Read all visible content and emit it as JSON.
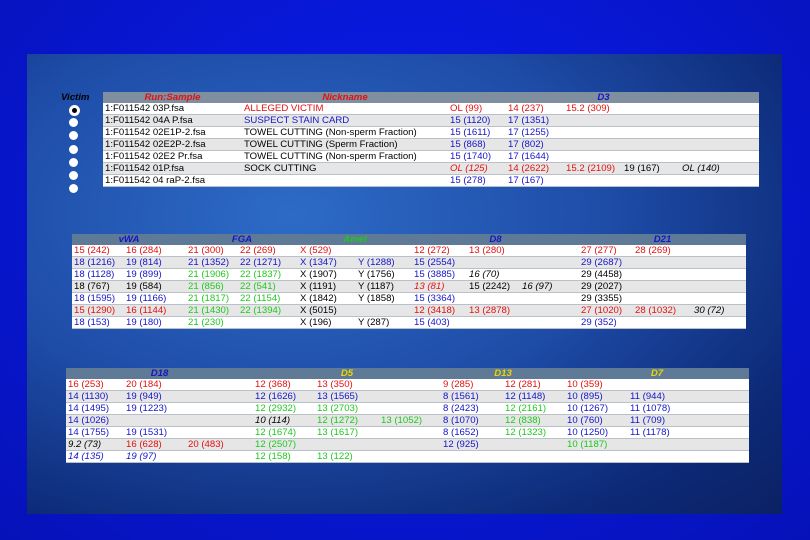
{
  "victim_label": "Victim",
  "victim_rows": [
    true,
    false,
    false,
    false,
    false,
    false,
    false
  ],
  "t1": {
    "headers": [
      "Run:Sample",
      "Nickname",
      "D3"
    ],
    "rows": [
      [
        [
          "1:F011542 03P.fsa",
          "black"
        ],
        [
          "ALLEGED VICTIM",
          "red"
        ],
        [
          [
            "OL (99)",
            "red"
          ],
          [
            "14 (237)",
            "red"
          ],
          [
            "15.2 (309)",
            "red"
          ],
          [
            "",
            ""
          ],
          [
            "",
            ""
          ]
        ]
      ],
      [
        [
          "1:F011542 04A P.fsa",
          "black"
        ],
        [
          "SUSPECT STAIN CARD",
          "blue"
        ],
        [
          [
            "15 (1120)",
            "blue"
          ],
          [
            "17 (1351)",
            "blue"
          ],
          [
            "",
            ""
          ],
          [
            "",
            ""
          ],
          [
            "",
            ""
          ]
        ]
      ],
      [
        [
          "1:F011542 02E1P-2.fsa",
          "black"
        ],
        [
          "TOWEL CUTTING (Non-sperm Fraction)",
          "black"
        ],
        [
          [
            "15 (1611)",
            "blue"
          ],
          [
            "17 (1255)",
            "blue"
          ],
          [
            "",
            ""
          ],
          [
            "",
            ""
          ],
          [
            "",
            ""
          ]
        ]
      ],
      [
        [
          "1:F011542 02E2P-2.fsa",
          "black"
        ],
        [
          "TOWEL CUTTING (Sperm Fraction)",
          "black"
        ],
        [
          [
            "15 (868)",
            "blue"
          ],
          [
            "17 (802)",
            "blue"
          ],
          [
            "",
            ""
          ],
          [
            "",
            ""
          ],
          [
            "",
            ""
          ]
        ]
      ],
      [
        [
          "1:F011542 02E2 Pr.fsa",
          "black"
        ],
        [
          "TOWEL CUTTING (Non-sperm Fraction)",
          "black"
        ],
        [
          [
            "15 (1740)",
            "blue"
          ],
          [
            "17 (1644)",
            "blue"
          ],
          [
            "",
            ""
          ],
          [
            "",
            ""
          ],
          [
            "",
            ""
          ]
        ]
      ],
      [
        [
          "1:F011542 01P.fsa",
          "black"
        ],
        [
          "SOCK CUTTING",
          "black"
        ],
        [
          [
            "OL (125)",
            "red it"
          ],
          [
            "14 (2622)",
            "red"
          ],
          [
            "15.2 (2109)",
            "red"
          ],
          [
            "19 (167)",
            "black"
          ],
          [
            "OL (140)",
            "black it"
          ]
        ]
      ],
      [
        [
          "1:F011542 04 raP-2.fsa",
          "black"
        ],
        [
          "",
          ""
        ],
        [
          [
            "15 (278)",
            "blue"
          ],
          [
            "17 (167)",
            "blue"
          ],
          [
            "",
            ""
          ],
          [
            "",
            ""
          ],
          [
            "",
            ""
          ]
        ]
      ]
    ]
  },
  "t2": {
    "headers": [
      "vWA",
      "FGA",
      "Amel",
      "D8",
      "D21"
    ],
    "rows": [
      [
        [
          "15 (242)",
          "red"
        ],
        [
          "16 (284)",
          "red"
        ],
        [
          "21 (300)",
          "red"
        ],
        [
          "22 (269)",
          "red"
        ],
        [
          "X (529)",
          "red"
        ],
        [
          "",
          ""
        ],
        [
          "12 (272)",
          "red"
        ],
        [
          "13 (280)",
          "red"
        ],
        [
          "",
          ""
        ],
        [
          "27 (277)",
          "red"
        ],
        [
          "28 (269)",
          "red"
        ],
        [
          "",
          ""
        ]
      ],
      [
        [
          "18 (1216)",
          "blue"
        ],
        [
          "19 (814)",
          "blue"
        ],
        [
          "21 (1352)",
          "blue"
        ],
        [
          "22 (1271)",
          "blue"
        ],
        [
          "X (1347)",
          "blue"
        ],
        [
          "Y (1288)",
          "blue"
        ],
        [
          "15 (2554)",
          "blue"
        ],
        [
          "",
          ""
        ],
        [
          "",
          ""
        ],
        [
          "29 (2687)",
          "blue"
        ],
        [
          "",
          ""
        ],
        [
          "",
          ""
        ]
      ],
      [
        [
          "18 (1128)",
          "blue"
        ],
        [
          "19 (899)",
          "blue"
        ],
        [
          "21 (1906)",
          "green"
        ],
        [
          "22 (1837)",
          "green"
        ],
        [
          "X (1907)",
          "black"
        ],
        [
          "Y (1756)",
          "black"
        ],
        [
          "15 (3885)",
          "blue"
        ],
        [
          "16 (70)",
          "black it"
        ],
        [
          "",
          ""
        ],
        [
          "29 (4458)",
          "black"
        ],
        [
          "",
          ""
        ],
        [
          "",
          ""
        ]
      ],
      [
        [
          "18 (767)",
          "black"
        ],
        [
          "19 (584)",
          "black"
        ],
        [
          "21 (856)",
          "green"
        ],
        [
          "22 (541)",
          "green"
        ],
        [
          "X (1191)",
          "black"
        ],
        [
          "Y (1187)",
          "black"
        ],
        [
          "13 (81)",
          "red it"
        ],
        [
          "15 (2242)",
          "black"
        ],
        [
          "16 (97)",
          "black it"
        ],
        [
          "29 (2027)",
          "black"
        ],
        [
          "",
          ""
        ],
        [
          "",
          ""
        ]
      ],
      [
        [
          "18 (1595)",
          "blue"
        ],
        [
          "19 (1166)",
          "blue"
        ],
        [
          "21 (1817)",
          "green"
        ],
        [
          "22 (1154)",
          "green"
        ],
        [
          "X (1842)",
          "black"
        ],
        [
          "Y (1858)",
          "black"
        ],
        [
          "15 (3364)",
          "blue"
        ],
        [
          "",
          ""
        ],
        [
          "",
          ""
        ],
        [
          "29 (3355)",
          "black"
        ],
        [
          "",
          ""
        ],
        [
          "",
          ""
        ]
      ],
      [
        [
          "15 (1290)",
          "red"
        ],
        [
          "16 (1144)",
          "red"
        ],
        [
          "21 (1430)",
          "green"
        ],
        [
          "22 (1394)",
          "green"
        ],
        [
          "X (5015)",
          "black"
        ],
        [
          "",
          ""
        ],
        [
          "12 (3418)",
          "red"
        ],
        [
          "13 (2878)",
          "red"
        ],
        [
          "",
          ""
        ],
        [
          "27 (1020)",
          "red"
        ],
        [
          "28 (1032)",
          "red"
        ],
        [
          "30 (72)",
          "black it"
        ]
      ],
      [
        [
          "18 (153)",
          "blue"
        ],
        [
          "19 (180)",
          "blue"
        ],
        [
          "21 (230)",
          "green"
        ],
        [
          "",
          ""
        ],
        [
          "X (196)",
          "black"
        ],
        [
          "Y (287)",
          "black"
        ],
        [
          "15 (403)",
          "blue"
        ],
        [
          "",
          ""
        ],
        [
          "",
          ""
        ],
        [
          "29 (352)",
          "blue"
        ],
        [
          "",
          ""
        ],
        [
          "",
          ""
        ]
      ]
    ]
  },
  "t3": {
    "headers": [
      "D18",
      "D5",
      "D13",
      "D7"
    ],
    "rows": [
      [
        [
          "16 (253)",
          "red"
        ],
        [
          "20 (184)",
          "red"
        ],
        [
          "",
          ""
        ],
        [
          "12 (368)",
          "red"
        ],
        [
          "13 (350)",
          "red"
        ],
        [
          "",
          ""
        ],
        [
          "9 (285)",
          "red"
        ],
        [
          "12 (281)",
          "red"
        ],
        [
          "10 (359)",
          "red"
        ],
        [
          "",
          ""
        ]
      ],
      [
        [
          "14 (1130)",
          "blue"
        ],
        [
          "19 (949)",
          "blue"
        ],
        [
          "",
          ""
        ],
        [
          "12 (1626)",
          "blue"
        ],
        [
          "13 (1565)",
          "blue"
        ],
        [
          "",
          ""
        ],
        [
          "8 (1561)",
          "blue"
        ],
        [
          "12 (1148)",
          "blue"
        ],
        [
          "10 (895)",
          "blue"
        ],
        [
          "11 (944)",
          "blue"
        ]
      ],
      [
        [
          "14 (1495)",
          "blue"
        ],
        [
          "19 (1223)",
          "blue"
        ],
        [
          "",
          ""
        ],
        [
          "12 (2932)",
          "green"
        ],
        [
          "13 (2703)",
          "green"
        ],
        [
          "",
          ""
        ],
        [
          "8 (2423)",
          "blue"
        ],
        [
          "12 (2161)",
          "green"
        ],
        [
          "10 (1267)",
          "blue"
        ],
        [
          "11 (1078)",
          "blue"
        ]
      ],
      [
        [
          "14 (1026)",
          "blue"
        ],
        [
          "",
          ""
        ],
        [
          "",
          ""
        ],
        [
          "10 (114)",
          "black it"
        ],
        [
          "12 (1272)",
          "green"
        ],
        [
          "13 (1052)",
          "green"
        ],
        [
          "8 (1070)",
          "blue"
        ],
        [
          "12 (838)",
          "green"
        ],
        [
          "10 (760)",
          "blue"
        ],
        [
          "11 (709)",
          "blue"
        ]
      ],
      [
        [
          "14 (1755)",
          "blue"
        ],
        [
          "19 (1531)",
          "blue"
        ],
        [
          "",
          ""
        ],
        [
          "12 (1674)",
          "green"
        ],
        [
          "13 (1617)",
          "green"
        ],
        [
          "",
          ""
        ],
        [
          "8 (1652)",
          "blue"
        ],
        [
          "12 (1323)",
          "green"
        ],
        [
          "10 (1250)",
          "blue"
        ],
        [
          "11 (1178)",
          "blue"
        ]
      ],
      [
        [
          "9.2 (73)",
          "black it"
        ],
        [
          "16 (628)",
          "red"
        ],
        [
          "20 (483)",
          "red"
        ],
        [
          "12 (2507)",
          "green"
        ],
        [
          "",
          ""
        ],
        [
          "",
          ""
        ],
        [
          "12 (925)",
          "blue"
        ],
        [
          "",
          ""
        ],
        [
          "10 (1187)",
          "green"
        ],
        [
          "",
          ""
        ]
      ],
      [
        [
          "14 (135)",
          "blue it"
        ],
        [
          "19 (97)",
          "blue it"
        ],
        [
          "",
          ""
        ],
        [
          "12 (158)",
          "green"
        ],
        [
          "13 (122)",
          "green"
        ],
        [
          "",
          ""
        ],
        [
          "",
          ""
        ],
        [
          "",
          ""
        ],
        [
          "",
          ""
        ],
        [
          "",
          ""
        ]
      ]
    ]
  },
  "colors": {
    "red": "#e31010",
    "blue": "#1515c8",
    "green": "#1ec81e",
    "black": "#000000"
  }
}
